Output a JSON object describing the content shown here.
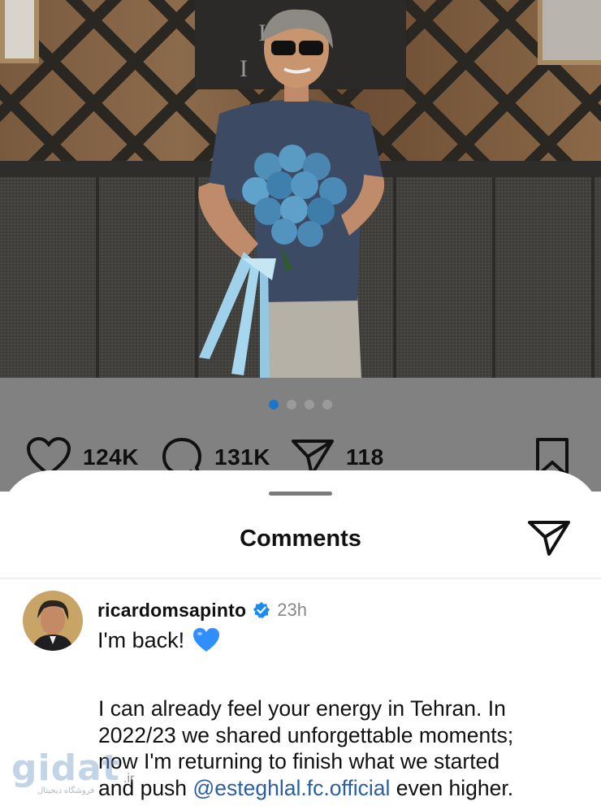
{
  "post": {
    "carousel": {
      "count": 4,
      "active_index": 0
    },
    "wall_sign_letters": [
      "I",
      "I"
    ],
    "actions": {
      "likes": "124K",
      "comments": "131K",
      "shares": "118"
    },
    "icons": {
      "like": "heart-outline-icon",
      "comment": "speech-bubble-icon",
      "share": "paper-plane-icon",
      "save": "bookmark-icon"
    }
  },
  "comments_sheet": {
    "title": "Comments",
    "share_icon": "paper-plane-icon",
    "comment": {
      "username": "ricardomsapinto",
      "verified": true,
      "time": "23h",
      "first_line": "I'm back!",
      "emoji": "blue-heart",
      "body_lines": [
        "I can already feel your energy in Tehran. In",
        "2022/23 we shared unforgettable moments;",
        "now I'm returning to finish what we started"
      ],
      "last_line_before": "and push ",
      "mention": "@esteghlal.fc.official",
      "last_line_after": " even higher."
    }
  },
  "watermark": {
    "text": "gidat",
    "suffix": ".ir",
    "subtitle": "فروشگاه دیجیتال"
  },
  "colors": {
    "accent_blue": "#1d75c8",
    "mention": "#2a5ea6",
    "verified": "#1d8cf0",
    "heart": "#2f8fff"
  }
}
